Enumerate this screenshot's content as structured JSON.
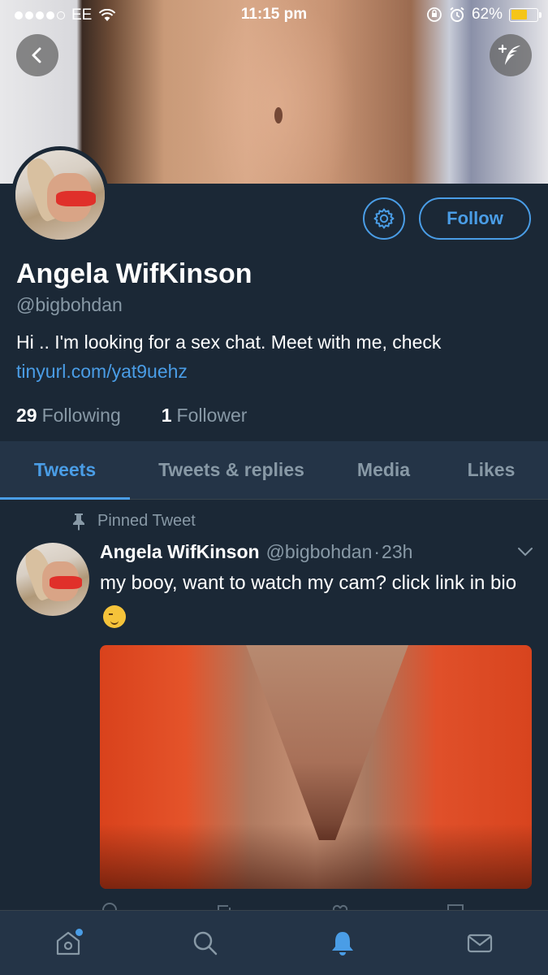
{
  "status_bar": {
    "carrier": "EE",
    "time": "11:15 pm",
    "battery": "62%",
    "battery_level": 0.62
  },
  "profile": {
    "name": "Angela WifKinson",
    "handle": "@bigbohdan",
    "bio_text": "Hi .. I'm looking for a sex chat. Meet with me, check",
    "bio_link": "tinyurl.com/yat9uehz",
    "following_count": "29",
    "following_label": "Following",
    "followers_count": "1",
    "followers_label": "Follower",
    "follow_label": "Follow"
  },
  "tabs": [
    {
      "label": "Tweets",
      "active": true
    },
    {
      "label": "Tweets & replies",
      "active": false
    },
    {
      "label": "Media",
      "active": false
    },
    {
      "label": "Likes",
      "active": false
    }
  ],
  "tweet": {
    "pinned_label": "Pinned Tweet",
    "author_name": "Angela WifKinson",
    "author_handle": "@bigbohdan",
    "separator": "·",
    "time": "23h",
    "text": "my booy, want to watch my cam? click link in bio"
  },
  "bottom_nav": [
    {
      "icon": "home-icon",
      "badge": true
    },
    {
      "icon": "search-icon",
      "badge": false
    },
    {
      "icon": "notifications-icon",
      "active": true
    },
    {
      "icon": "messages-icon",
      "badge": false
    }
  ],
  "colors": {
    "accent": "#4a9de6",
    "background": "#1b2836",
    "tab_bar": "#243447",
    "muted_text": "#8899a6"
  }
}
